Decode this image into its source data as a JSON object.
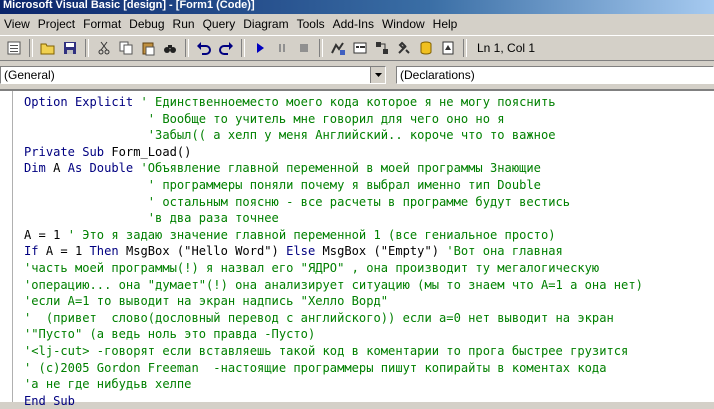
{
  "window": {
    "title": "Microsoft Visual Basic [design] - [Form1 (Code)]"
  },
  "menu": [
    "View",
    "Project",
    "Format",
    "Debug",
    "Run",
    "Query",
    "Diagram",
    "Tools",
    "Add-Ins",
    "Window",
    "Help"
  ],
  "toolbar": {
    "icons": [
      "project-explorer-icon",
      "open-icon",
      "save-icon",
      "cut-icon",
      "copy-icon",
      "paste-icon",
      "find-icon",
      "undo-icon",
      "redo-icon",
      "run-icon",
      "pause-icon",
      "stop-icon",
      "design-icon",
      "properties-icon",
      "object-browser-icon",
      "toolbox-icon",
      "data-view-icon",
      "visual-component-icon"
    ],
    "position": "Ln 1, Col 1"
  },
  "object_combo": {
    "value": "(General)"
  },
  "procedure_combo": {
    "value": "(Declarations)"
  },
  "code": {
    "lines": [
      [
        {
          "t": "Option Explicit ",
          "c": "kw"
        },
        {
          "t": "' Единственноеместо моего кода которое я не могу пояснить",
          "c": "cm"
        }
      ],
      [
        {
          "t": "                 ",
          "c": "tx"
        },
        {
          "t": "' Вообще то учитель мне говорил для чего оно но я",
          "c": "cm"
        }
      ],
      [
        {
          "t": "                 ",
          "c": "tx"
        },
        {
          "t": "'Забыл(( а хелп у меня Английский.. короче что то важное",
          "c": "cm"
        }
      ],
      [
        {
          "t": "Private Sub ",
          "c": "kw"
        },
        {
          "t": "Form_Load()",
          "c": "tx"
        }
      ],
      [
        {
          "t": "Dim ",
          "c": "kw"
        },
        {
          "t": "A ",
          "c": "tx"
        },
        {
          "t": "As Double ",
          "c": "kw"
        },
        {
          "t": "'Объявление главной переменной в моей программы Знающие",
          "c": "cm"
        }
      ],
      [
        {
          "t": "                 ",
          "c": "tx"
        },
        {
          "t": "' программеры поняли почему я выбрал именно тип Double",
          "c": "cm"
        }
      ],
      [
        {
          "t": "                 ",
          "c": "tx"
        },
        {
          "t": "' остальным поясню - все расчеты в программе будут вестись",
          "c": "cm"
        }
      ],
      [
        {
          "t": "                 ",
          "c": "tx"
        },
        {
          "t": "'в два раза точнее",
          "c": "cm"
        }
      ],
      [
        {
          "t": "A = 1 ",
          "c": "tx"
        },
        {
          "t": "' Это я задаю значение главной переменной 1 (все гениальное просто)",
          "c": "cm"
        }
      ],
      [
        {
          "t": "If ",
          "c": "kw"
        },
        {
          "t": "A = 1 ",
          "c": "tx"
        },
        {
          "t": "Then ",
          "c": "kw"
        },
        {
          "t": "MsgBox (\"Hello Word\") ",
          "c": "tx"
        },
        {
          "t": "Else ",
          "c": "kw"
        },
        {
          "t": "MsgBox (\"Empty\") ",
          "c": "tx"
        },
        {
          "t": "'Вот она главная",
          "c": "cm"
        }
      ],
      [
        {
          "t": "'часть моей программы(!) я назвал его \"ЯДРО\" , она производит ту мегалогическую",
          "c": "cm"
        }
      ],
      [
        {
          "t": "'операцию... она \"думает\"(!) она анализирует ситуацию (мы то знаем что А=1 а она нет)",
          "c": "cm"
        }
      ],
      [
        {
          "t": "'если А=1 то выводит на экран надпись \"Хелло Ворд\"",
          "c": "cm"
        }
      ],
      [
        {
          "t": "'  (привет  слово(дословный перевод с английского)) если а=0 нет выводит на экран",
          "c": "cm"
        }
      ],
      [
        {
          "t": "'\"Пусто\" (а ведь ноль это правда -Пусто)",
          "c": "cm"
        }
      ],
      [
        {
          "t": "'<lj-cut> -говорят если вставляешь такой код в коментарии то прога быстрее грузится",
          "c": "cm"
        }
      ],
      [
        {
          "t": "' (c)2005 Gordon Freeman  -настоящие программеры пишут копирайты в коментах кода",
          "c": "cm"
        }
      ],
      [
        {
          "t": "'а не где нибудьв хелпе",
          "c": "cm"
        }
      ],
      [
        {
          "t": "End Sub",
          "c": "kw"
        }
      ]
    ]
  }
}
